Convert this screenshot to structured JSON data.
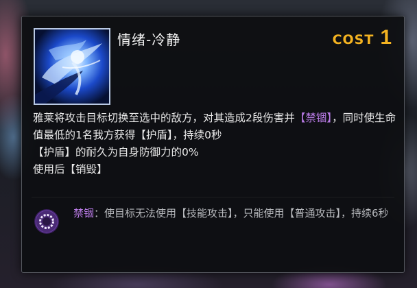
{
  "card": {
    "title": "情绪-冷静",
    "cost_label": "COST",
    "cost_value": "1",
    "portrait_icon": "blue-spirit-portrait",
    "description": [
      [
        {
          "text": "雅莱将攻击目标切换至选中的敌方，对其造成2段伤害并",
          "kw": false
        },
        {
          "text": "【禁锢】",
          "kw": true
        },
        {
          "text": "，同时使生命值最低的1名我方获得【护盾】，持续0秒",
          "kw": false
        }
      ],
      [
        {
          "text": "【护盾】的耐久为自身防御力的0%",
          "kw": false
        }
      ],
      [
        {
          "text": "使用后【销毁】",
          "kw": false
        }
      ]
    ],
    "status": {
      "icon": "chain-ring-icon",
      "name": "禁锢",
      "text": "：使目标无法使用【技能攻击】，只能使用【普通攻击】，持续6秒"
    }
  },
  "colors": {
    "cost": "#f4b321",
    "keyword": "#b97be6",
    "panel_bg": "#0e0f12",
    "body_text": "#e9e9e9",
    "status_text": "#b7b9bd"
  }
}
